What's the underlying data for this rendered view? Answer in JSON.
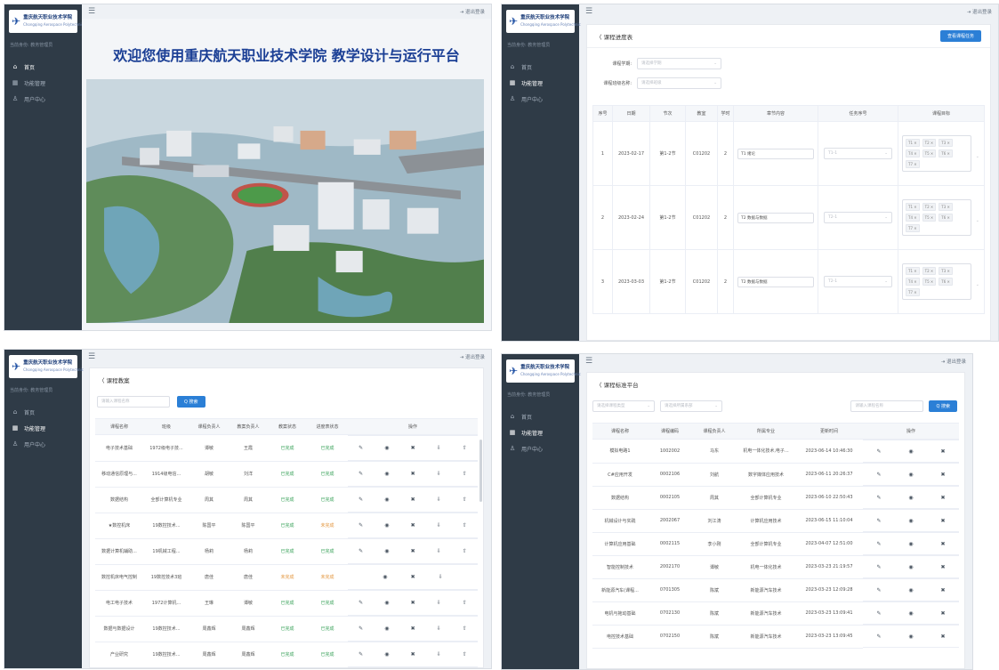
{
  "common": {
    "logo_cn": "重庆航天职业技术学院",
    "logo_en": "Chongqing Aerospace Polytechnic",
    "role": "当前身份: 教务管理员",
    "nav": [
      "首页",
      "功能管理",
      "用户中心"
    ],
    "logout": "退出登录",
    "menu_icon": "hamburger-icon"
  },
  "s1": {
    "welcome": "欢迎您使用重庆航天职业技术学院 教学设计与运行平台",
    "image_alt": "campus-aerial-view"
  },
  "s2": {
    "back": "课程进度表",
    "action_button": "查看课程任务",
    "filters": [
      {
        "label": "课程学期:",
        "placeholder": "请选择学期"
      },
      {
        "label": "课程班级名称:",
        "placeholder": "请选择班级"
      }
    ],
    "columns": [
      "序号",
      "日期",
      "节次",
      "教室",
      "学时",
      "章节内容",
      "任务序号",
      "课程目标"
    ],
    "rows": [
      {
        "no": "1",
        "date": "2023-02-17",
        "section": "第1-2节",
        "room": "C01202",
        "hours": "2",
        "content": "T1 绪论",
        "task": "T1-1",
        "targets": [
          "T1",
          "T2",
          "T3",
          "T4",
          "T5",
          "T6",
          "T7"
        ]
      },
      {
        "no": "2",
        "date": "2023-02-24",
        "section": "第1-2节",
        "room": "C01202",
        "hours": "2",
        "content": "T2 数据与数据",
        "task": "T2-1",
        "targets": [
          "T1",
          "T2",
          "T3",
          "T4",
          "T5",
          "T6",
          "T7"
        ]
      },
      {
        "no": "3",
        "date": "2023-03-03",
        "section": "第1-2节",
        "room": "C01202",
        "hours": "2",
        "content": "T2 数据与数据",
        "task": "T2-1",
        "targets": [
          "T1",
          "T2",
          "T3",
          "T4",
          "T5",
          "T6",
          "T7"
        ]
      }
    ]
  },
  "s3": {
    "back": "课程教案",
    "search_placeholder": "请输入课程名称",
    "search_button": "Q 搜索",
    "columns": [
      "课程名称",
      "班级",
      "课程负责人",
      "教案负责人",
      "教案状态",
      "进度表状态",
      "操作"
    ],
    "rows": [
      {
        "name": "电子技术基础",
        "cls": "1972级电子技...",
        "owner": "谭敏",
        "author": "王霞",
        "s1": "已完成",
        "s1c": "ok",
        "s2": "已完成",
        "s2c": "ok",
        "ops": [
          "编辑",
          "查看",
          "删除",
          "导出",
          "上传"
        ]
      },
      {
        "name": "移动通信原理与...",
        "cls": "1914级电信...",
        "owner": "胡敏",
        "author": "刘洋",
        "s1": "已完成",
        "s1c": "ok",
        "s2": "已完成",
        "s2c": "ok",
        "ops": [
          "编辑",
          "查看",
          "删除",
          "导出",
          "上传"
        ]
      },
      {
        "name": "数据结构",
        "cls": "全部计算机专业",
        "owner": "周其",
        "author": "周其",
        "s1": "已完成",
        "s1c": "ok",
        "s2": "已完成",
        "s2c": "ok",
        "ops": [
          "编辑",
          "查看",
          "删除",
          "导出",
          "上传"
        ]
      },
      {
        "name": "★数控机床",
        "cls": "19数控技术...",
        "owner": "陈国平",
        "author": "陈国平",
        "s1": "已完成",
        "s1c": "ok",
        "s2": "未完成",
        "s2c": "warn",
        "ops": [
          "编辑",
          "查看",
          "删除",
          "导出",
          "上传"
        ]
      },
      {
        "name": "数据计算机辅助...",
        "cls": "19机械工程...",
        "owner": "杨莉",
        "author": "杨莉",
        "s1": "已完成",
        "s1c": "ok",
        "s2": "已完成",
        "s2c": "ok",
        "ops": [
          "编辑",
          "查看",
          "删除",
          "导出",
          "上传"
        ]
      },
      {
        "name": "数控机床电气控制",
        "cls": "19数控技术3班",
        "owner": "唐佳",
        "author": "唐佳",
        "s1": "未完成",
        "s1c": "warn",
        "s2": "未完成",
        "s2c": "warn",
        "ops": [
          "",
          "查看",
          "删除",
          "导出",
          ""
        ]
      },
      {
        "name": "电工电子技术",
        "cls": "1972计算机...",
        "owner": "王琳",
        "author": "谭敏",
        "s1": "已完成",
        "s1c": "ok",
        "s2": "已完成",
        "s2c": "ok",
        "ops": [
          "编辑",
          "查看",
          "删除",
          "导出",
          "上传"
        ]
      },
      {
        "name": "数据与数据设计",
        "cls": "19数控技术...",
        "owner": "周鑫辉",
        "author": "周鑫辉",
        "s1": "已完成",
        "s1c": "ok",
        "s2": "已完成",
        "s2c": "ok",
        "ops": [
          "编辑",
          "查看",
          "删除",
          "导出",
          "上传"
        ]
      },
      {
        "name": "产业研究",
        "cls": "19数控技术...",
        "owner": "周鑫辉",
        "author": "周鑫辉",
        "s1": "已完成",
        "s1c": "ok",
        "s2": "已完成",
        "s2c": "ok",
        "ops": [
          "编辑",
          "查看",
          "删除",
          "导出",
          "上传"
        ]
      }
    ]
  },
  "s4": {
    "back": "课程标准平台",
    "filter1": "请选择课程类型",
    "filter2": "请选择所属系部",
    "search_placeholder": "请输入课程名称",
    "search_button": "Q 搜索",
    "columns": [
      "课程名称",
      "课程编码",
      "课程负责人",
      "所属专业",
      "更新时间",
      "操作"
    ],
    "rows": [
      {
        "name": "模拟电路1",
        "code": "1002002",
        "owner": "马东",
        "major": "机电一体化技术,电子...",
        "time": "2023-06-14 10:46:30"
      },
      {
        "name": "C#应用开发",
        "code": "0002106",
        "owner": "刘航",
        "major": "数字媒体应用技术",
        "time": "2023-06-11 20:26:37"
      },
      {
        "name": "数据结构",
        "code": "0002105",
        "owner": "周其",
        "major": "全部计算机专业",
        "time": "2023-06-10 22:50:43"
      },
      {
        "name": "机械设计与实践",
        "code": "2002067",
        "owner": "刘江涛",
        "major": "计算机应用技术",
        "time": "2023-06-15 11:10:04"
      },
      {
        "name": "计算机应用基础",
        "code": "0002115",
        "owner": "李小刚",
        "major": "全部计算机专业",
        "time": "2023-04-07 12:51:00"
      },
      {
        "name": "智能控制技术",
        "code": "2002170",
        "owner": "谭敏",
        "major": "机电一体化技术",
        "time": "2023-03-23 21:19:57"
      },
      {
        "name": "新能源汽车(课程...",
        "code": "0701305",
        "owner": "陈斌",
        "major": "新能源汽车技术",
        "time": "2023-03-23 12:09:28"
      },
      {
        "name": "电机与拖动基础",
        "code": "0702130",
        "owner": "陈斌",
        "major": "新能源汽车技术",
        "time": "2023-03-23 13:09:41"
      },
      {
        "name": "电控技术基础",
        "code": "0702150",
        "owner": "陈斌",
        "major": "新能源汽车技术",
        "time": "2023-03-23 13:09:45"
      }
    ]
  }
}
